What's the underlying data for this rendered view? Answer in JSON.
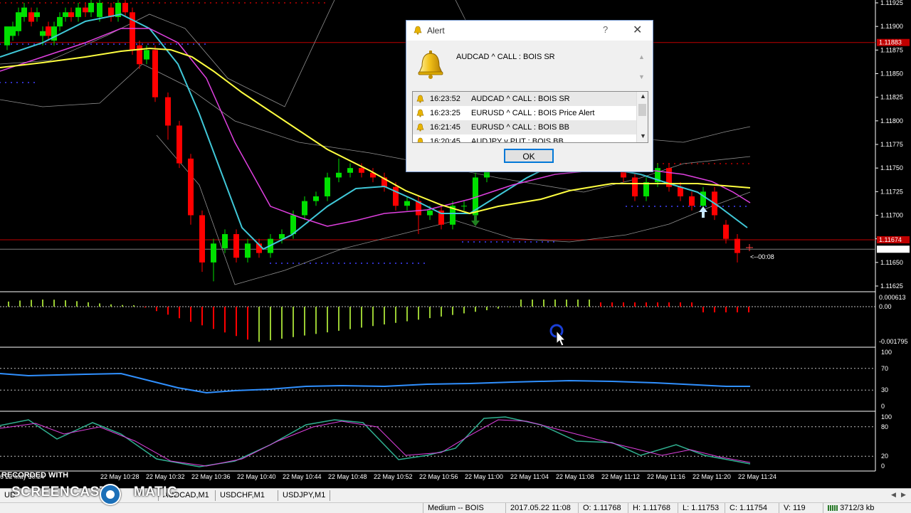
{
  "chart": {
    "symbol_hint": "EURUSD,M1",
    "price_levels": [
      "1.11925",
      "1.11900",
      "1.11875",
      "1.11850",
      "1.11825",
      "1.11800",
      "1.11775",
      "1.11750",
      "1.11725",
      "1.11700",
      "1.11675",
      "1.11650",
      "1.11625"
    ],
    "price_level_values": [
      1.11925,
      1.119,
      1.11875,
      1.1185,
      1.11825,
      1.118,
      1.11775,
      1.1175,
      1.11725,
      1.117,
      1.11675,
      1.1165,
      1.11625
    ],
    "alert_line_price": "1.11883",
    "alert_line_value": 1.11883,
    "alert_line_low_price": "1.11674",
    "alert_line_low_value": 1.11674,
    "current_price": "1.11664",
    "current_price_value": 1.11664,
    "countdown": "<--00:08",
    "osc1_levels": [
      "0.000613",
      "0.00",
      "-0.001795"
    ],
    "rsi_levels": [
      "100",
      "70",
      "30",
      "0"
    ],
    "stoch_levels": [
      "100",
      "80",
      "20",
      "0"
    ],
    "time_labels": [
      "6 22 May 10:24",
      "22 May 10:28",
      "22 May 10:32",
      "22 May 10:36",
      "22 May 10:40",
      "22 May 10:44",
      "22 May 10:48",
      "22 May 10:52",
      "22 May 10:56",
      "22 May 11:00",
      "22 May 11:04",
      "22 May 11:08",
      "22 May 11:12",
      "22 May 11:16",
      "22 May 11:20",
      "22 May 11:24"
    ],
    "colors": {
      "bull": "#00e000",
      "bear": "#ff0000",
      "ma_cyan": "#40c8d8",
      "ma_magenta": "#e040e0",
      "ma_yellow": "#ffff40",
      "band": "#909090",
      "alert_line": "#c00000",
      "osc_up": "#9acd32",
      "osc_down": "#ff0000",
      "rsi": "#3090ff",
      "stoch_main": "#30b090",
      "stoch_signal": "#e040e0"
    }
  },
  "tabs": [
    "UD",
    "AUDCAD,M1",
    "USDCHF,M1",
    "USDJPY,M1"
  ],
  "status": {
    "profile": "Medium -- BOIS",
    "datetime": "2017.05.22 11:08",
    "open": "O: 1.11768",
    "high": "H: 1.11768",
    "low": "L: 1.11753",
    "close": "C: 1.11754",
    "volume": "V: 119",
    "traffic": "3712/3 kb"
  },
  "watermark": {
    "line1": "RECORDED WITH",
    "line2": "SCREENCAST",
    "line3": "MATIC"
  },
  "alert": {
    "title": "Alert",
    "help": "?",
    "close": "✕",
    "message": "AUDCAD ^ CALL : BOIS SR",
    "rows": [
      {
        "time": "16:23:52",
        "text": "AUDCAD ^ CALL : BOIS SR"
      },
      {
        "time": "16:23:25",
        "text": "EURUSD ^ CALL : BOIS Price Alert"
      },
      {
        "time": "16:21:45",
        "text": "EURUSD ^ CALL : BOIS BB"
      },
      {
        "time": "16:20:45",
        "text": "AUDJPY v PUT : BOIS BB"
      }
    ],
    "ok_label": "OK",
    "icons": {
      "bell": "bell-icon",
      "scroll_up": "▲",
      "scroll_down": "▼"
    }
  }
}
